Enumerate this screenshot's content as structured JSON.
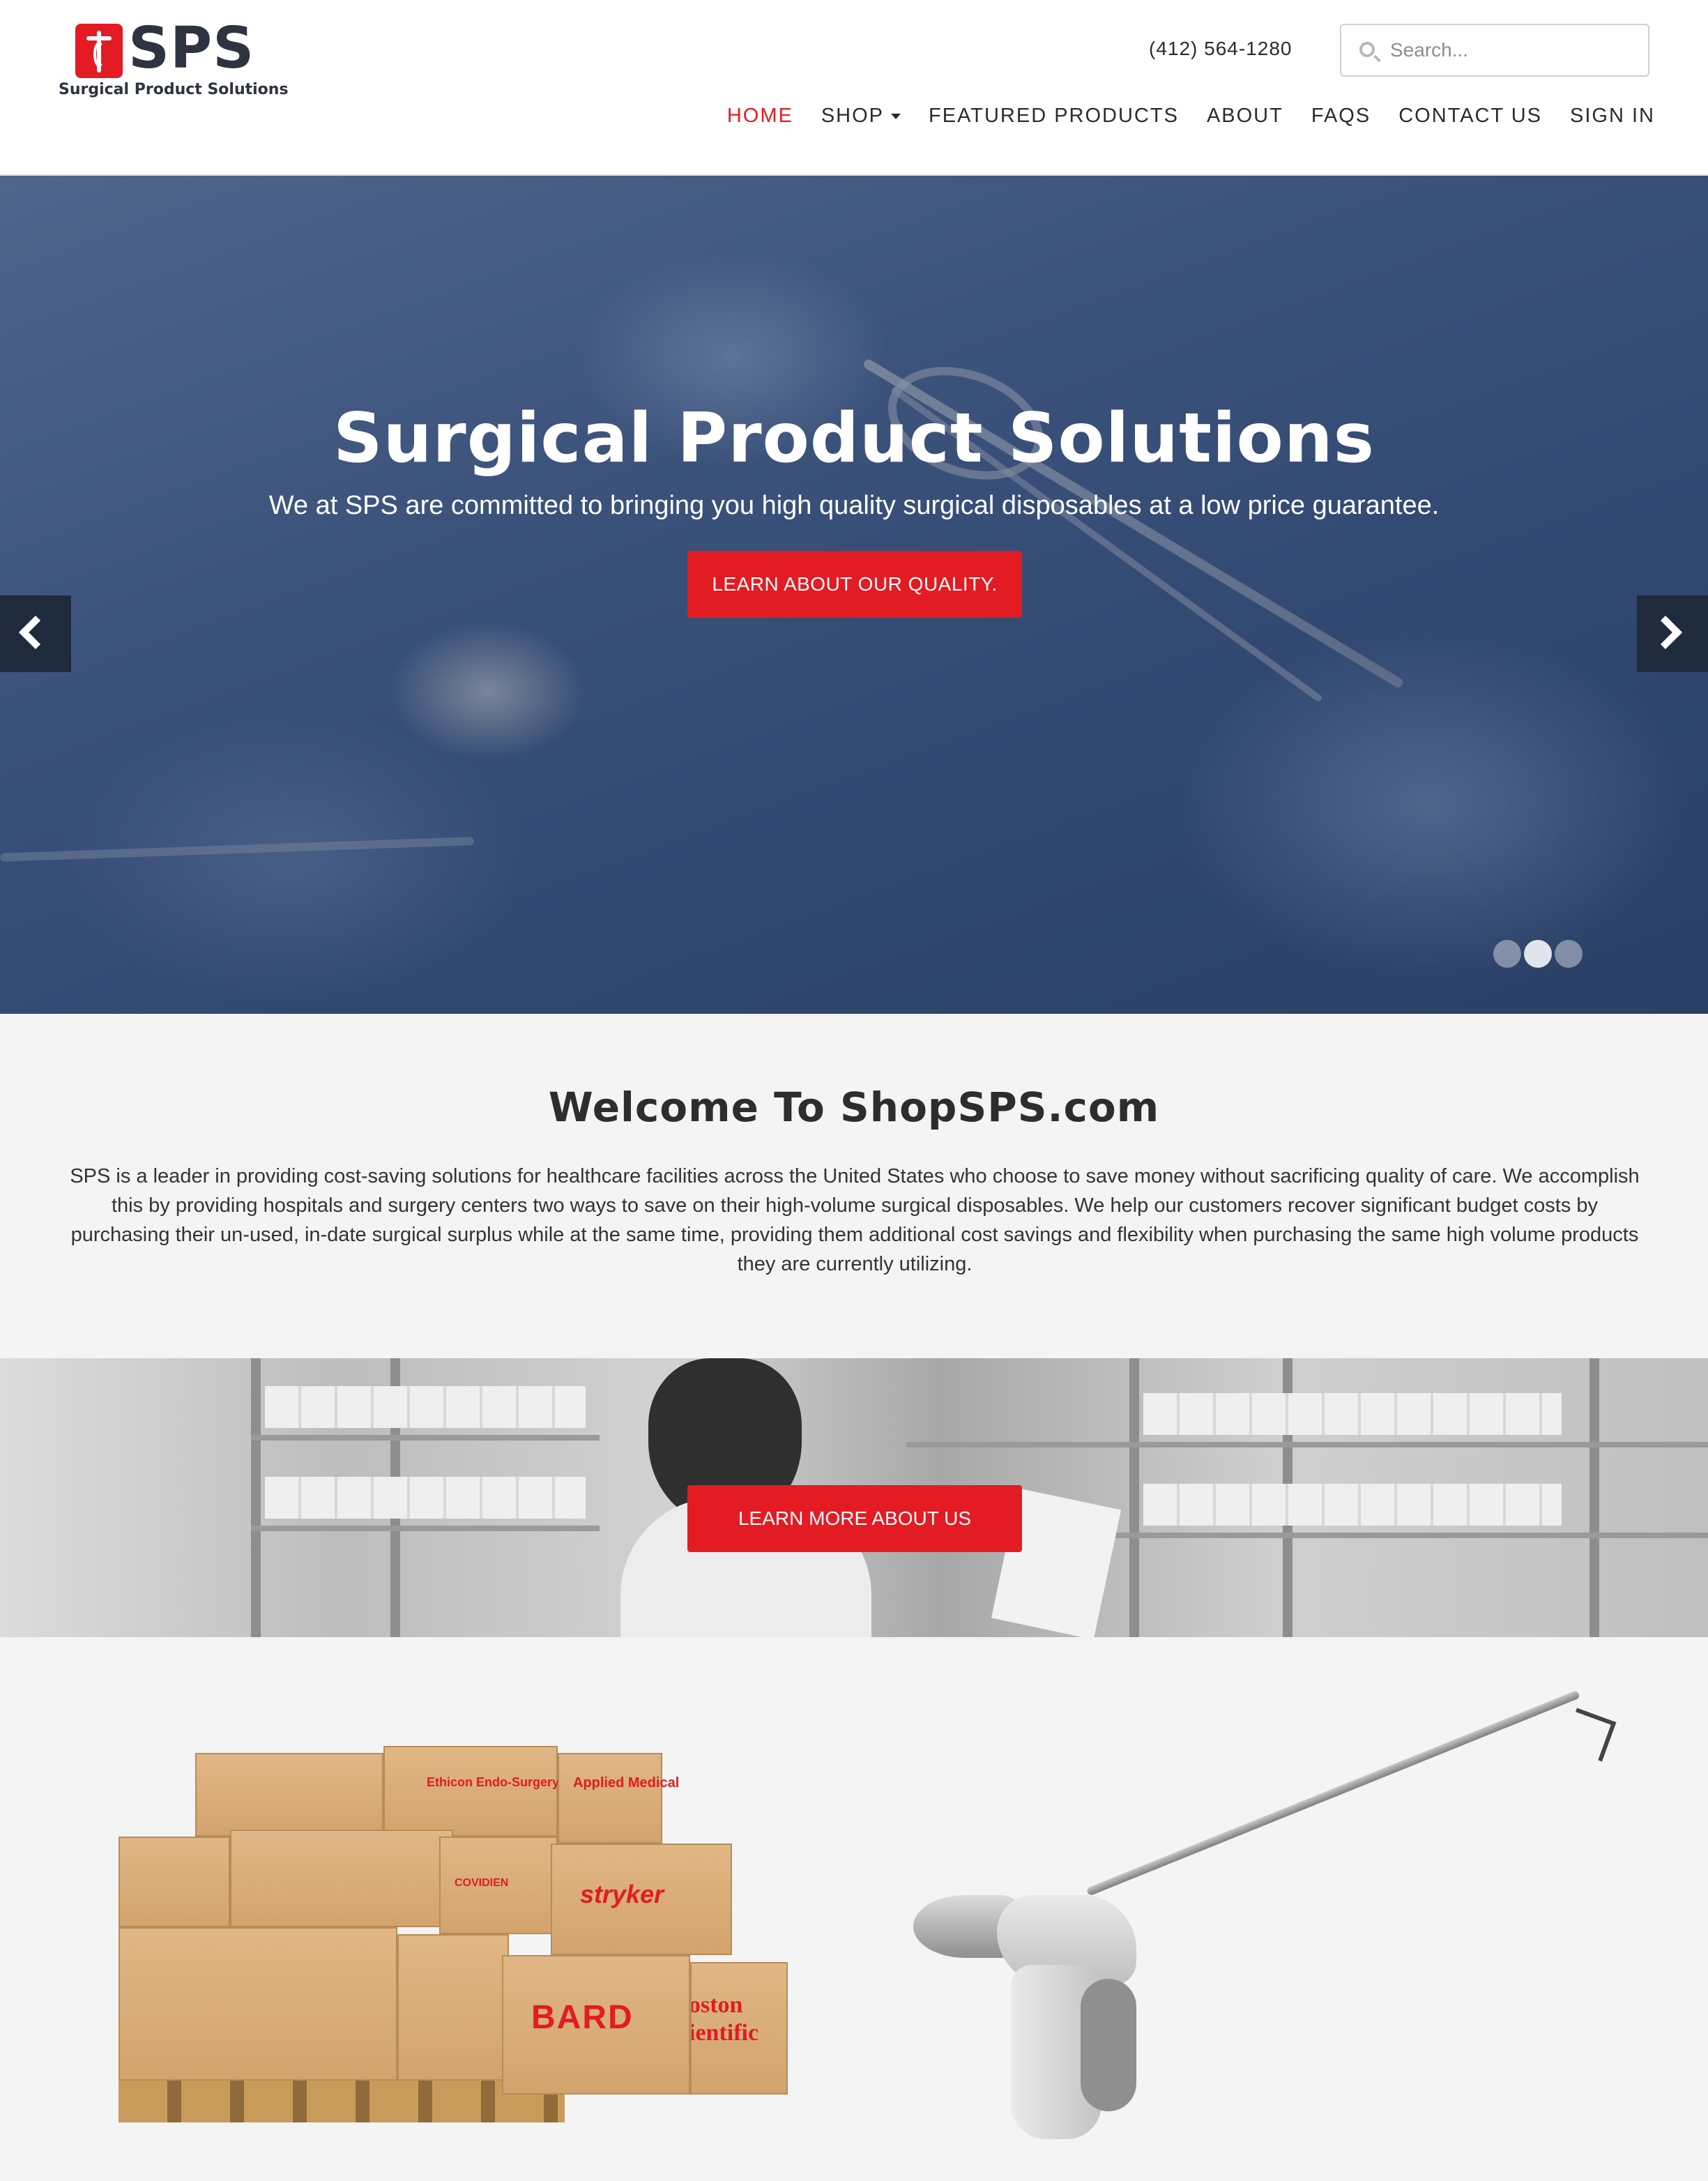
{
  "header": {
    "logo_text": "SPS",
    "logo_subtitle": "Surgical Product Solutions",
    "phone": "(412) 564-1280",
    "search_placeholder": "Search...",
    "nav": [
      {
        "label": "HOME",
        "active": true
      },
      {
        "label": "SHOP",
        "has_dropdown": true
      },
      {
        "label": "FEATURED PRODUCTS"
      },
      {
        "label": "ABOUT"
      },
      {
        "label": "FAQS"
      },
      {
        "label": "CONTACT US"
      },
      {
        "label": "SIGN IN"
      }
    ]
  },
  "hero": {
    "title": "Surgical Product Solutions",
    "subtitle": "We at SPS are committed to bringing you high quality surgical disposables at a low price guarantee.",
    "button_label": "LEARN ABOUT OUR QUALITY.",
    "slide_count": 3,
    "active_slide": 2
  },
  "welcome": {
    "title": "Welcome To ShopSPS.com",
    "body": "SPS is a leader in providing cost-saving solutions for healthcare facilities across the United States who choose to save money without sacrificing quality of care. We accomplish this by providing hospitals and surgery centers two ways to save on their high-volume surgical disposables. We help our customers recover significant budget costs by purchasing their un-used, in-date surgical surplus while at the same time, providing them additional cost savings and flexibility when purchasing the same high volume products they are currently utilizing."
  },
  "banner": {
    "button_label": "LEARN MORE ABOUT US"
  },
  "products": {
    "box_brands": [
      "Ethicon Endo-Surgery",
      "Applied Medical",
      "COVIDIEN",
      "stryker",
      "BARD",
      "oston ientific"
    ]
  },
  "colors": {
    "accent": "#e31b23",
    "text_dark": "#2b2b2b",
    "background": "#f4f4f4"
  },
  "icons": {
    "search": "search-icon",
    "prev": "chevron-left-icon",
    "next": "chevron-right-icon",
    "dropdown": "caret-down-icon"
  }
}
